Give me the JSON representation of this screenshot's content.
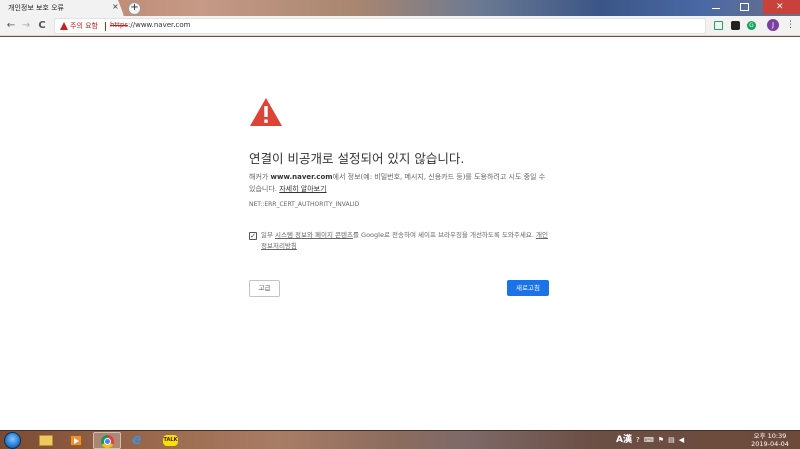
{
  "browser": {
    "tab_title": "개인정보 보호 오류",
    "tab_close": "×",
    "new_tab": "+",
    "nav_back": "←",
    "nav_forward": "→",
    "nav_reload": "C",
    "security_label": "주의 요함",
    "url_scheme": "https",
    "url_rest": "://www.naver.com",
    "bookmark_star": "☆",
    "ext_green": "G",
    "profile_initial": "J",
    "menu": "⋮"
  },
  "error_page": {
    "heading": "연결이 비공개로 설정되어 있지 않습니다.",
    "intro_prefix": "해커가 ",
    "intro_domain": "www.naver.com",
    "intro_suffix": "에서 정보(예: 비밀번호, 메시지, 신용카드 등)를 도용하려고 시도 중일 수 있습니다.",
    "learn_more": "자세히 알아보기",
    "error_code": "NET::ERR_CERT_AUTHORITY_INVALID",
    "checkbox_mark": "✓",
    "opt_prefix": "일부 ",
    "opt_link": "시스템 정보와 페이지 콘텐츠",
    "opt_suffix": "를 Google로 전송하여 세이프 브라우징을 개선하도록 도와주세요.",
    "privacy_link": "개인정보처리방침",
    "advanced_button": "고급",
    "reload_button": "새로고침",
    "colors": {
      "warning_red": "#c5221f",
      "primary_blue": "#1a73e8"
    }
  },
  "taskbar": {
    "ie_glyph": "e",
    "kakao_label": "TALK",
    "ime": "A漢",
    "tray_icons": [
      "help-icon",
      "keyboard-icon",
      "flag-icon",
      "network-icon",
      "volume-icon"
    ],
    "clock_time": "오후 10:39",
    "clock_date": "2019-04-04"
  }
}
